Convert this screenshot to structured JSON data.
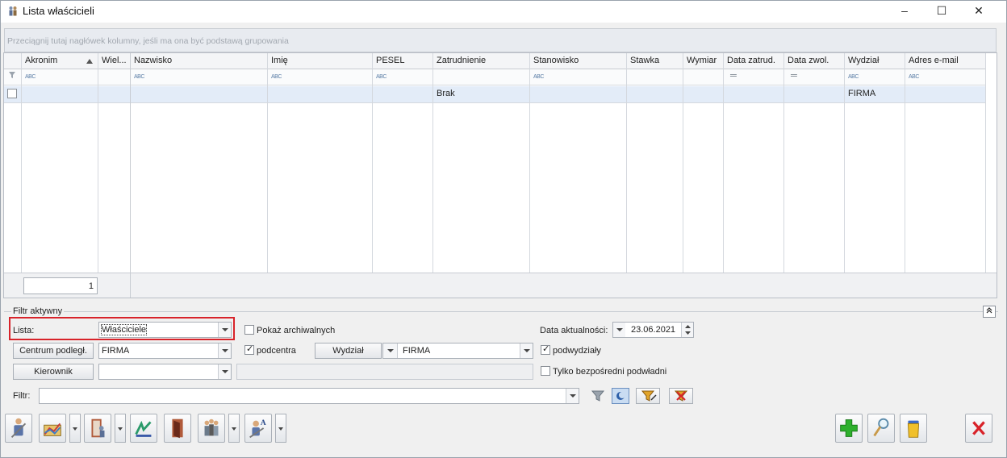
{
  "window": {
    "title": "Lista właścicieli",
    "minimize": "–",
    "maximize": "☐",
    "close": "✕"
  },
  "grid": {
    "group_hint": "Przeciągnij tutaj nagłówek kolumny, jeśli ma ona być podstawą grupowania",
    "columns": [
      "Akronim",
      "Wiel...",
      "Nazwisko",
      "Imię",
      "PESEL",
      "Zatrudnienie",
      "Stanowisko",
      "Stawka",
      "Wymiar",
      "Data zatrud.",
      "Data zwol.",
      "Wydział",
      "Adres e-mail"
    ],
    "filter_glyph": "ABC",
    "filter_eq": "═",
    "rows": [
      {
        "zatrudnienie": "Brak",
        "wydzial": "FIRMA"
      }
    ],
    "record_count": "1"
  },
  "filter": {
    "legend": "Filtr aktywny",
    "lista_label": "Lista:",
    "lista_value": "Właściciele",
    "pokaz_archiwalnych": "Pokaż archiwalnych",
    "data_aktualnosci_label": "Data aktualności:",
    "data_aktualnosci_value": "23.06.2021",
    "centrum_button": "Centrum podległ.",
    "centrum_value": "FIRMA",
    "podcentra": "podcentra",
    "wydzial_button": "Wydział",
    "wydzial_value": "FIRMA",
    "podwydzialy": "podwydziały",
    "kierownik_button": "Kierownik",
    "kierownik_value": "",
    "tylko_bezposredni": "Tylko bezpośredni podwładni",
    "filtr_label": "Filtr:",
    "filtr_value": ""
  }
}
